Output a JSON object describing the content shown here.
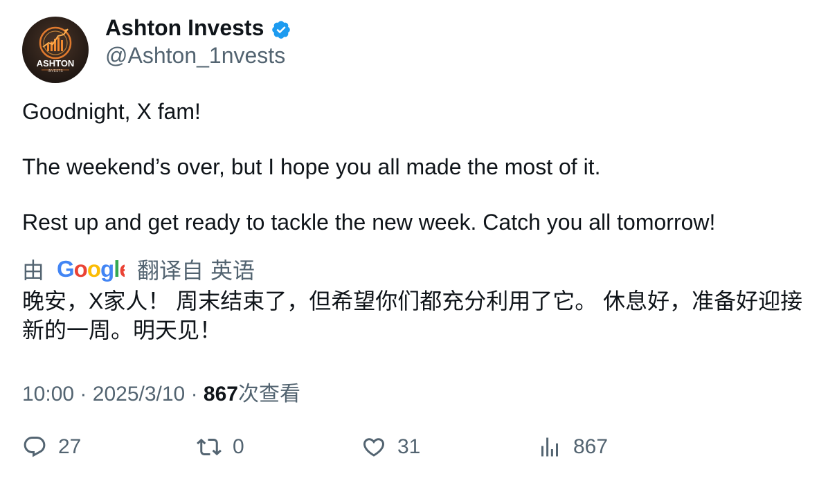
{
  "author": {
    "display_name": "Ashton Invests",
    "handle": "@Ashton_1nvests",
    "avatar_title": "ASHTON",
    "avatar_subtitle": "INVESTS",
    "verified_icon": "verified-badge-icon"
  },
  "tweet": {
    "lines": [
      "Goodnight, X fam!",
      "The weekend’s over, but I hope you all made the most of it.",
      "Rest up and get ready to tackle the new week. Catch you all tomorrow!"
    ]
  },
  "translation": {
    "prefix": "由",
    "provider": "Google",
    "label": "翻译自",
    "language": "英语",
    "text_line1": "晚安，X家人！ 周末结束了，但希望你们都充分利用了它。 休息好，准备好迎接",
    "text_line2": "新的一周。明天见！"
  },
  "meta": {
    "time": "10:00",
    "separator": "·",
    "date": "2025/3/10",
    "views_count": "867",
    "views_label": "次查看"
  },
  "actions": {
    "replies": "27",
    "reposts": "0",
    "likes": "31",
    "views": "867"
  },
  "colors": {
    "text_primary": "#0f1419",
    "text_secondary": "#536471",
    "verified": "#1d9bf0",
    "google_blue": "#4285f4",
    "google_red": "#ea4335",
    "google_yellow": "#fbbc05",
    "google_green": "#34a853"
  }
}
